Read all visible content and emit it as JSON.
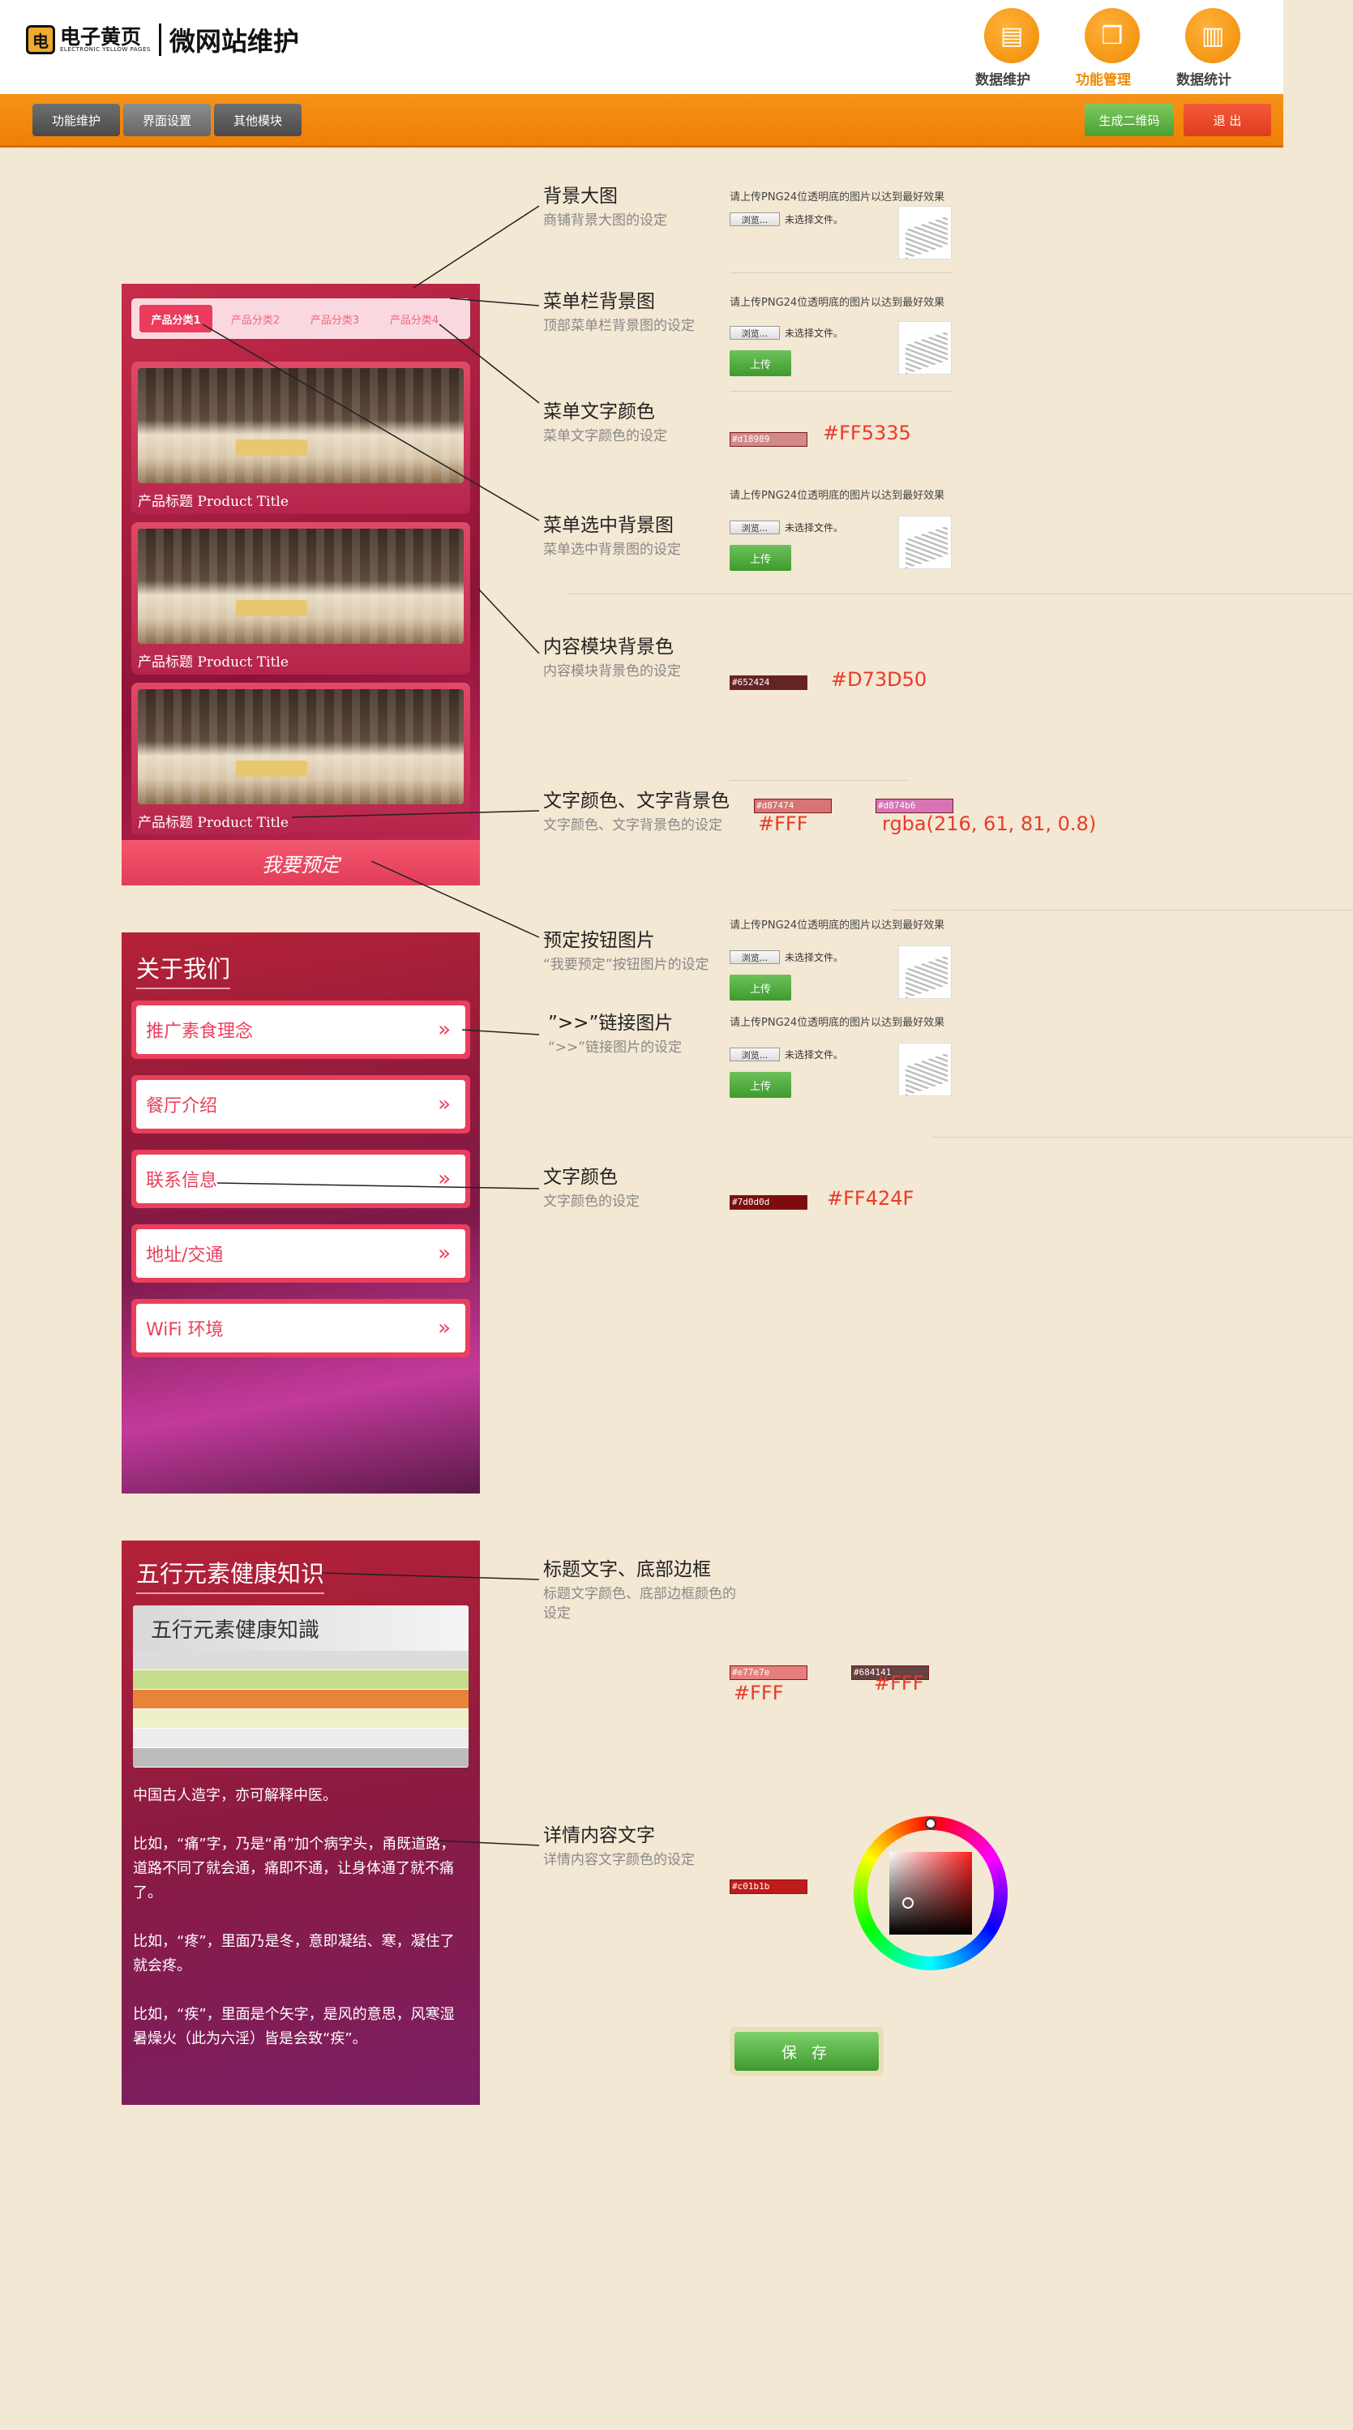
{
  "header": {
    "logo_icon": "电",
    "logo_cn": "电子黄页",
    "logo_en": "ELECTRONIC YELLOW PAGES",
    "title": "微网站维护",
    "nav": [
      {
        "label": "数据维护",
        "icon": "document-icon"
      },
      {
        "label": "功能管理",
        "icon": "box-icon"
      },
      {
        "label": "数据统计",
        "icon": "chart-icon"
      }
    ]
  },
  "toolbar": {
    "tabs": [
      "功能维护",
      "界面设置",
      "其他模块"
    ],
    "qr_label": "生成二维码",
    "logout_label": "退 出"
  },
  "preview1": {
    "menu_tabs": [
      "产品分类1",
      "产品分类2",
      "产品分类3",
      "产品分类4"
    ],
    "card_title": "产品标题 Product Title",
    "book_label": "我要预定"
  },
  "preview2": {
    "title": "关于我们",
    "items": [
      "推广素食理念",
      "餐厅介绍",
      "联系信息",
      "地址/交通",
      "WiFi 环境"
    ],
    "arrow": "»"
  },
  "preview3": {
    "title": "五行元素健康知识",
    "table_title": "五行元素健康知識",
    "paragraphs": [
      "中国古人造字，亦可解释中医。",
      "比如，“痛”字，乃是“甬”加个病字头，甬既道路，道路不同了就会通，痛即不通，让身体通了就不痛了。",
      "比如，“疼”，里面乃是冬，意即凝结、寒，凝住了就会疼。",
      "比如，“疾”，里面是个矢字，是风的意思，风寒湿暑燥火（此为六淫）皆是会致“疾”。"
    ]
  },
  "settings": {
    "upload_hint": "请上传PNG24位透明底的图片以达到最好效果",
    "browse_label": "浏览...",
    "no_file": "未选择文件。",
    "upload_label": "上传",
    "bg": {
      "title": "背景大图",
      "sub": "商铺背景大图的设定"
    },
    "menubar": {
      "title": "菜单栏背景图",
      "sub": "顶部菜单栏背景图的设定"
    },
    "menutext": {
      "title": "菜单文字颜色",
      "sub": "菜单文字颜色的设定",
      "swatch": "#d18989",
      "value": "#FF5335"
    },
    "menusel": {
      "title": "菜单选中背景图",
      "sub": "菜单选中背景图的设定"
    },
    "content": {
      "title": "内容模块背景色",
      "sub": "内容模块背景色的设定",
      "swatch": "#652424",
      "value": "#D73D50"
    },
    "textbg": {
      "title": "文字颜色、文字背景色",
      "sub": "文字颜色、文字背景色的设定",
      "swatch1": "#d87474",
      "swatch2": "#d874b6",
      "value1": "#FFF",
      "value2": "rgba(216, 61, 81, 0.8)"
    },
    "book": {
      "title": "预定按钮图片",
      "sub": "“我要预定”按钮图片的设定"
    },
    "link": {
      "title": "”>>”链接图片",
      "sub": "“>>”链接图片的设定"
    },
    "textcolor": {
      "title": "文字颜色",
      "sub": "文字颜色的设定",
      "swatch": "#7d0d0d",
      "value": "#FF424F"
    },
    "titleborder": {
      "title": "标题文字、底部边框",
      "sub": "标题文字颜色、底部边框颜色的设定",
      "swatch1": "#e77e7e",
      "swatch2": "#684141",
      "value1": "#FFF",
      "value2": "#FFF"
    },
    "detail": {
      "title": "详情内容文字",
      "sub": "详情内容文字颜色的设定",
      "swatch": "#c01b1b"
    },
    "save_label": "保 存"
  }
}
